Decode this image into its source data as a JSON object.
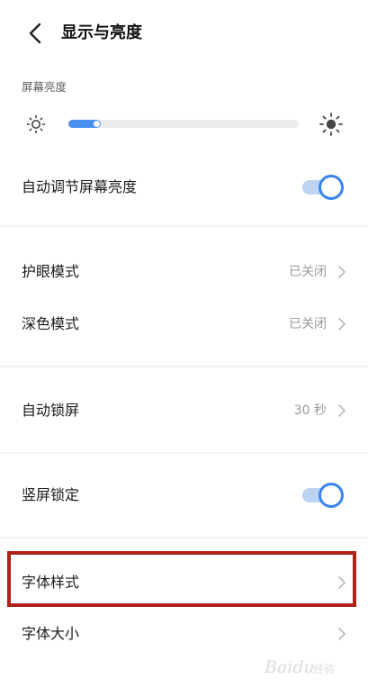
{
  "header": {
    "title": "显示与亮度"
  },
  "brightness": {
    "label": "屏幕亮度",
    "level": 0.14
  },
  "rows": [
    {
      "label": "自动调节屏幕亮度",
      "type": "toggle",
      "on": true
    },
    {
      "label": "护眼模式",
      "type": "nav",
      "value": "已关闭"
    },
    {
      "label": "深色模式",
      "type": "nav",
      "value": "已关闭"
    },
    {
      "label": "自动锁屏",
      "type": "nav",
      "value": "30 秒"
    },
    {
      "label": "竖屏锁定",
      "type": "toggle",
      "on": true
    },
    {
      "label": "字体样式",
      "type": "nav",
      "value": ""
    },
    {
      "label": "字体大小",
      "type": "nav",
      "value": ""
    }
  ],
  "watermark": {
    "text": "Baidu",
    "sub": "经验"
  },
  "colors": {
    "accent": "#3a84ee",
    "highlight_border": "#b0211a"
  }
}
